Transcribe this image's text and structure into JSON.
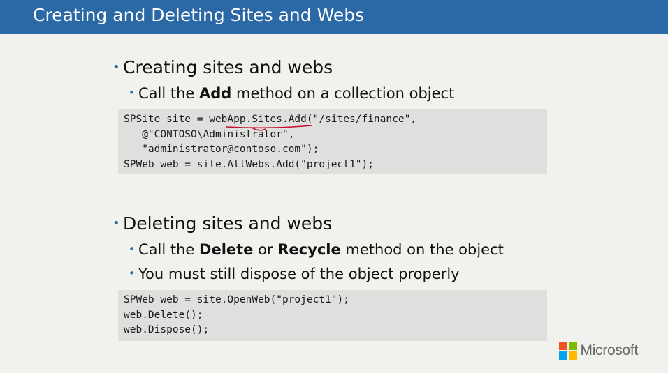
{
  "title": "Creating and Deleting Sites and Webs",
  "section1": {
    "heading": "Creating sites and webs",
    "sub1": {
      "prefix": "Call the ",
      "bold": "Add",
      "suffix": " method on a collection object"
    },
    "code": [
      "SPSite site = webApp.Sites.Add(\"/sites/finance\",",
      "   @\"CONTOSO\\Administrator\",",
      "   \"administrator@contoso.com\");",
      "SPWeb web = site.AllWebs.Add(\"project1\");"
    ]
  },
  "section2": {
    "heading": "Deleting sites and webs",
    "sub1": {
      "prefix": "Call the ",
      "bold1": "Delete",
      "mid": " or ",
      "bold2": "Recycle",
      "suffix": " method on the object"
    },
    "sub2": "You must still dispose of the object properly",
    "code": [
      "SPWeb web = site.OpenWeb(\"project1\");",
      "web.Delete();",
      "web.Dispose();"
    ]
  },
  "logo": {
    "text": "Microsoft",
    "colors": [
      "#f25022",
      "#7fba00",
      "#00a4ef",
      "#ffb900"
    ]
  },
  "colors": {
    "title_bar": "#2b68a6",
    "background": "#f1f2ee",
    "code_background": "#dfe0dd",
    "annotation_ink": "#c8102e"
  }
}
